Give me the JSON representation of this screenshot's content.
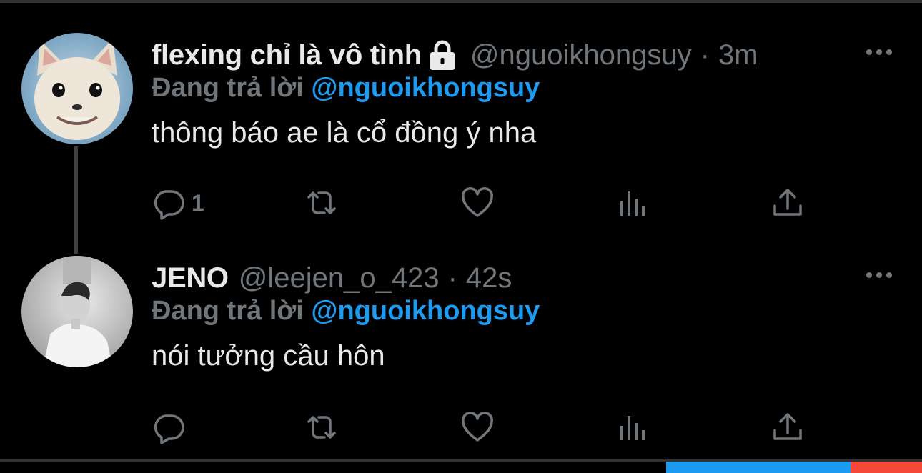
{
  "tweets": [
    {
      "display_name": "flexing chỉ là vô tình",
      "locked": true,
      "handle": "@nguoikhongsuy",
      "separator": "·",
      "timestamp": "3m",
      "reply_label": "Đang trả lời",
      "reply_to": "@nguoikhongsuy",
      "text": "thông báo ae là cổ đồng ý nha",
      "reply_count": "1"
    },
    {
      "display_name": "JENO",
      "locked": false,
      "handle": "@leejen_o_423",
      "separator": "·",
      "timestamp": "42s",
      "reply_label": "Đang trả lời",
      "reply_to": "@nguoikhongsuy",
      "text": "nói tưởng cầu hôn",
      "reply_count": ""
    }
  ],
  "icons": {
    "reply": "speech-bubble-icon",
    "retweet": "retweet-icon",
    "like": "heart-icon",
    "views": "bar-chart-icon",
    "share": "share-upload-icon",
    "more": "more-dots-icon",
    "lock": "lock-icon"
  },
  "colors": {
    "background": "#000000",
    "primary_text": "#e7e9ea",
    "secondary_text": "#71767b",
    "accent": "#1d9bf0",
    "thread_line": "#3e4144",
    "strip_red": "#f4483b"
  }
}
